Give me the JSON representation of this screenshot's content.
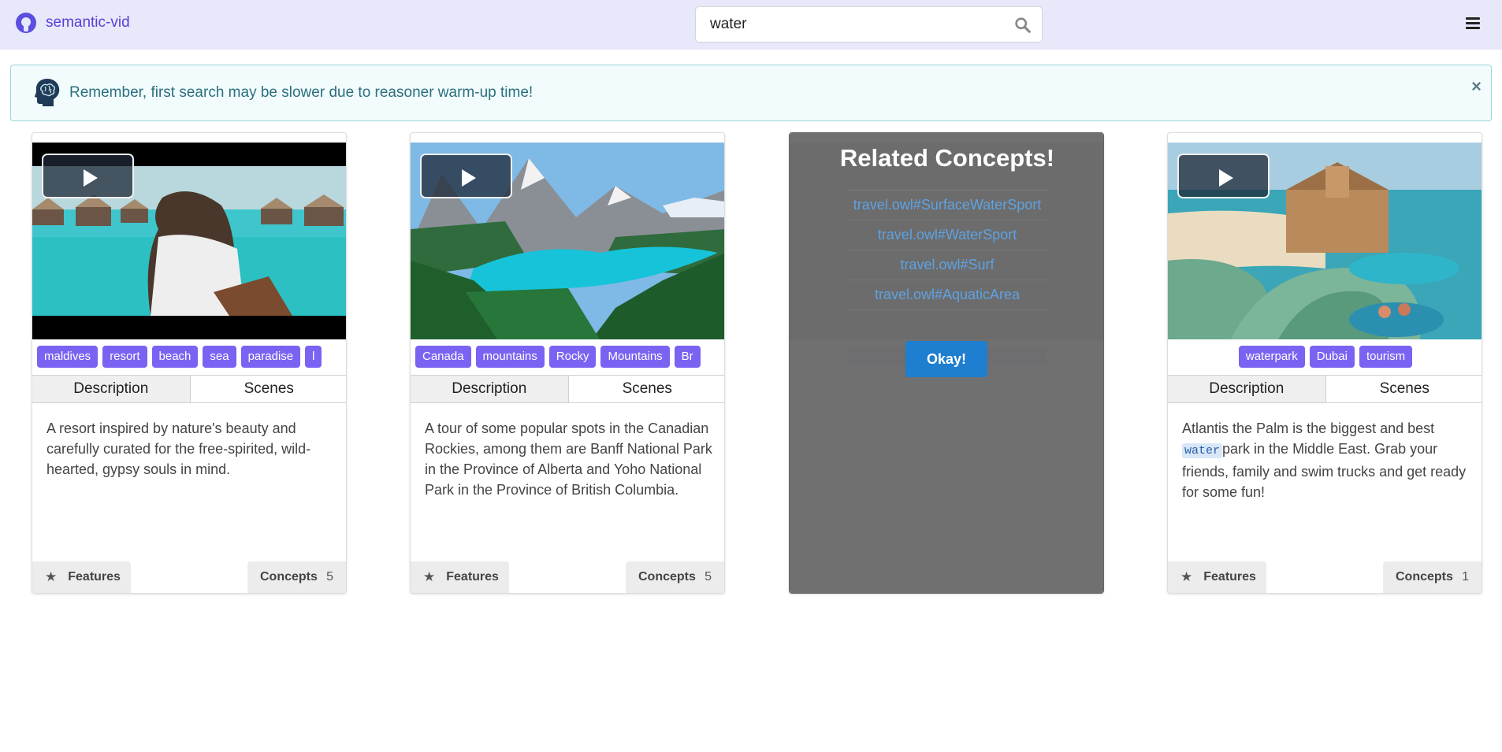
{
  "navbar": {
    "brand": "semantic-vid",
    "search_value": "water"
  },
  "notice": {
    "text": "Remember, first search may be slower due to reasoner warm-up time!",
    "close": "×"
  },
  "cards": [
    {
      "tags": [
        "maldives",
        "resort",
        "beach",
        "sea",
        "paradise",
        "l"
      ],
      "tab_description": "Description",
      "tab_scenes": "Scenes",
      "description": "A resort inspired by nature's beauty and carefully curated for the free-spirited, wild-hearted, gypsy souls in mind.",
      "features": "Features",
      "concepts": "Concepts",
      "concepts_count": "5"
    },
    {
      "tags": [
        "Canada",
        "mountains",
        "Rocky",
        "Mountains",
        "Br"
      ],
      "tab_description": "Description",
      "tab_scenes": "Scenes",
      "description": "A tour of some popular spots in the Canadian Rockies, among them are Banff National Park in the Province of Alberta and Yoho National Park in the Province of British Columbia.",
      "features": "Features",
      "concepts": "Concepts",
      "concepts_count": "5"
    },
    {
      "overlay_title": "Related Concepts!",
      "related": [
        "travel.owl#SurfaceWaterSport",
        "travel.owl#WaterSport",
        "travel.owl#Surf",
        "travel.owl#AquaticArea"
      ],
      "okay": "Okay!"
    },
    {
      "tags": [
        "waterpark",
        "Dubai",
        "tourism"
      ],
      "tab_description": "Description",
      "tab_scenes": "Scenes",
      "description_pre": "Atlantis the Palm is the biggest and best",
      "description_hl": "water",
      "description_post": "park in the Middle East. Grab your friends, family and swim trucks and get ready for some fun!",
      "features": "Features",
      "concepts": "Concepts",
      "concepts_count": "1"
    }
  ],
  "colors": {
    "navbar_bg": "#e8e8fb",
    "tag": "#7a63f2",
    "link": "#5ea2e3",
    "okay": "#1e7ecf"
  }
}
